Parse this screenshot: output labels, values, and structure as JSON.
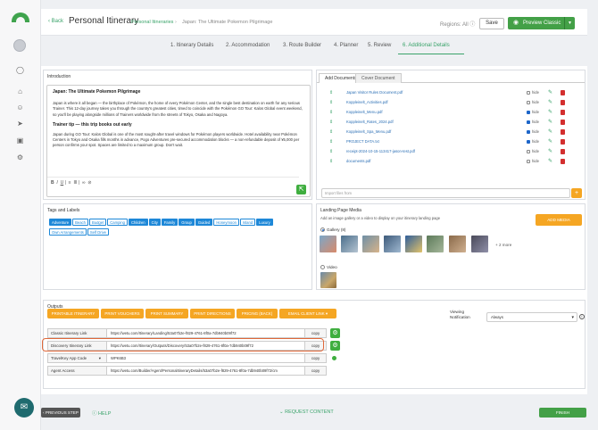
{
  "topbar": {
    "back_label": "Back",
    "title": "Personal Itinerary",
    "breadcrumb": [
      "Personal Itineraries",
      "Japan: The Ultimate Pokemon Pilgrimage"
    ],
    "regions_label": "Regions: All",
    "save_label": "Save",
    "preview_label": "Preview Classic"
  },
  "steps": [
    {
      "label": "1. Itinerary Details"
    },
    {
      "label": "2. Accommodation"
    },
    {
      "label": "3. Route Builder"
    },
    {
      "label": "4. Planner"
    },
    {
      "label": "5. Review"
    },
    {
      "label": "6. Additional Details"
    }
  ],
  "introduction": {
    "title": "Introduction",
    "heading": "Japan: The Ultimate Pokemon Pilgrimage",
    "para1": "Japan is where it all began — the birthplace of Pokémon, the home of every Pokémon Center, and the single best destination on earth for any serious Trainer. This 12-day journey takes you through the country's greatest cities, timed to coincide with the Pokémon GO Tour: Kalos Global event weekend, so you'll be playing alongside millions of Trainers worldwide from the streets of Tokyo, Osaka and Nagoya.",
    "subheading": "Trainer tip — this trip books out early",
    "para2": "Japan during GO Tour: Kalos Global is one of the most sought-after travel windows for Pokémon players worldwide. Hotel availability near Pokémon Centers in Tokyo and Osaka fills months in advance, Pogo Adventures pre-secured accommodation blocks — a non-refundable deposit of ¥5,000 per person confirms your spot. Spaces are limited to a maximum group. Don't wait."
  },
  "documents": {
    "tabs": [
      "Add Documents",
      "Cover Document"
    ],
    "hide_label": "hide",
    "files": [
      {
        "name": "Japan Visitor Rules Document.pdf",
        "hidden": false
      },
      {
        "name": "Koppleinelt_Activities.pdf",
        "hidden": false
      },
      {
        "name": "Koppleinelt_Menu.pdf",
        "hidden": true
      },
      {
        "name": "Koppleinelt_Rates_2024.pdf",
        "hidden": true
      },
      {
        "name": "Koppleinelt_Spa_Menu.pdf",
        "hidden": true
      },
      {
        "name": "PROJECT DATA.txt",
        "hidden": true
      },
      {
        "name": "receipt-2024-10-15-113417-jason-test.pdf",
        "hidden": false
      },
      {
        "name": "documents.pdf",
        "hidden": false
      }
    ],
    "import_placeholder": "Import files from"
  },
  "tags": {
    "title": "Tags and Labels",
    "items": [
      {
        "label": "Adventure",
        "on": true
      },
      {
        "label": "Beach",
        "on": false
      },
      {
        "label": "Budget",
        "on": false
      },
      {
        "label": "Camping",
        "on": false
      },
      {
        "label": "Children",
        "on": true
      },
      {
        "label": "City",
        "on": true
      },
      {
        "label": "Family",
        "on": true
      },
      {
        "label": "Group",
        "on": true
      },
      {
        "label": "Guided",
        "on": true
      },
      {
        "label": "Honeymoon",
        "on": false
      },
      {
        "label": "Island",
        "on": false
      },
      {
        "label": "Luxury",
        "on": true
      },
      {
        "label": "Own Arrangements",
        "on": false
      },
      {
        "label": "Self Drive",
        "on": false
      }
    ]
  },
  "media": {
    "title": "Landing Page Media",
    "subtitle": "Add an image gallery or a video to display on your itinerary landing page",
    "add_label": "ADD MEDIA",
    "gallery_label": "Gallery (8)",
    "more_label": "+ 2 more",
    "video_label": "Video"
  },
  "outputs": {
    "title": "Outputs",
    "buttons": [
      "PRINTABLE ITINERARY",
      "PRINT VOUCHERS",
      "PRINT SUMMARY",
      "PRINT DIRECTIONS",
      "PRICING (BACK)",
      "EMAIL CLIENT LINK"
    ],
    "viewing_label": "Viewing Notification",
    "viewing_value": "Always",
    "copy_label": "copy",
    "rows": [
      {
        "label": "Classic Itinerary Link",
        "value": "https://wetu.com/Itinerary/Landing/53a07b2e-f829-4761-8f0a-7db940b09f72"
      },
      {
        "label": "Discovery Itinerary Link",
        "value": "https://wetu.com/Itinerary/Outputs/Discovery/53a07b2e-f829-4761-8f0a-7db940b09f72"
      },
      {
        "label": "TravelKey App Code",
        "value": "WPK6B3"
      },
      {
        "label": "Agent Access",
        "value": "https://wetu.com/Builder/Agent/PersonalItineraryDetails/53a07b2e-f829-4761-8f0a-7db940b09f72/cm"
      }
    ]
  },
  "footer": {
    "prev_label": "PREVIOUS STEP",
    "help_label": "HELP",
    "request_label": "REQUEST CONTENT",
    "finish_label": "FINISH"
  }
}
